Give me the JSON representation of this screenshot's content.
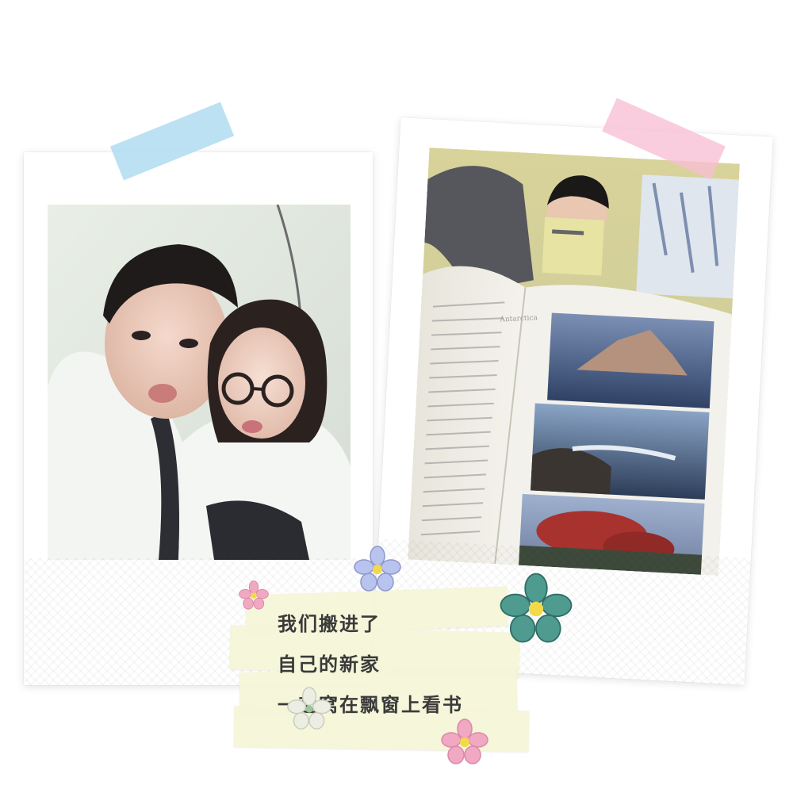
{
  "caption": {
    "line1": "我们搬进了",
    "line2": "自己的新家",
    "line3": "一起窝在飘窗上看书"
  },
  "photo_left": {
    "subject": "couple-selfie-photo"
  },
  "photo_right": {
    "subject": "reading-book-photo",
    "book_page_label": "Antarctica"
  },
  "colors": {
    "tape_blue": "#a8d8ef",
    "tape_pink": "#f7bfd3",
    "note_paper": "#f5f6d9",
    "flower_blue": "#b9c3ef",
    "flower_pink": "#f1a8c2",
    "flower_teal": "#3f8e83"
  }
}
